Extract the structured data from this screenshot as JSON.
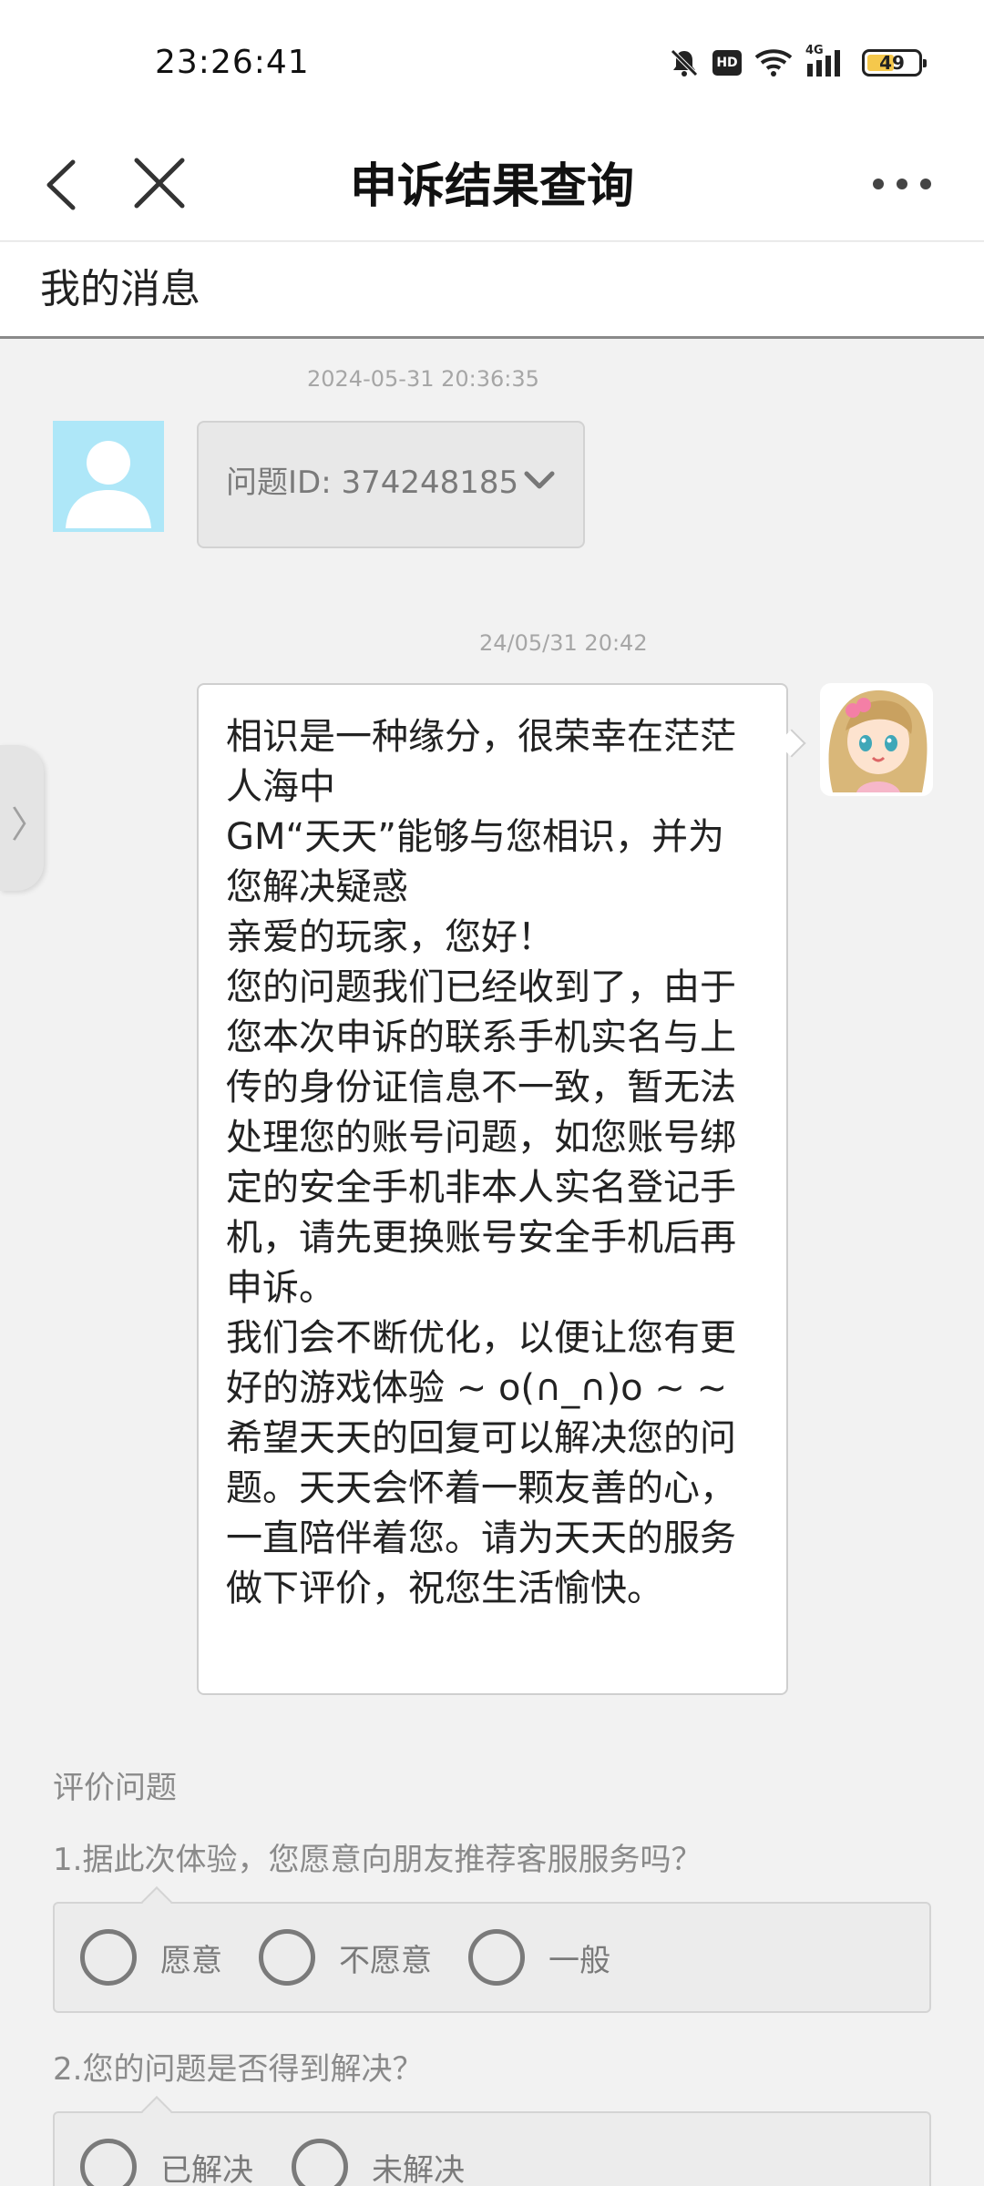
{
  "status_bar": {
    "time": "23:26:41",
    "icons": [
      "bell-muted-icon",
      "hd-icon",
      "wifi-icon",
      "signal-4g-icon"
    ],
    "network_label": "4G",
    "hd_label": "HD",
    "battery_level": "49",
    "battery_fill_color": "#f5c84c"
  },
  "nav": {
    "title": "申诉结果查询",
    "back_icon": "chevron-left-icon",
    "close_icon": "close-icon",
    "more_icon": "more-icon"
  },
  "section": {
    "title": "我的消息"
  },
  "messages": [
    {
      "timestamp": "2024-05-31 20:36:35",
      "sender": "user",
      "text": "问题ID: 374248185"
    },
    {
      "timestamp": "24/05/31 20:42",
      "sender": "gm",
      "lines": [
        "相识是一种缘分，很荣幸在茫茫人海中",
        "GM“天天”能够与您相识，并为您解决疑惑",
        "亲爱的玩家，您好！",
        "您的问题我们已经收到了，由于您本次申诉的联系手机实名与上传的身份证信息不一致，暂无法处理您的账号问题，如您账号绑定的安全手机非本人实名登记手机，请先更换账号安全手机后再申诉。",
        "我们会不断优化，以便让您有更好的游戏体验 ~ o(∩_∩)o ~ ~",
        "希望天天的回复可以解决您的问题。天天会怀着一颗友善的心，一直陪伴着您。请为天天的服务做下评价，祝您生活愉快。"
      ]
    }
  ],
  "side_handle": {
    "label": "〉"
  },
  "rating": {
    "title": "评价问题",
    "questions": [
      {
        "text": "1.据此次体验，您愿意向朋友推荐客服服务吗？",
        "options": [
          "愿意",
          "不愿意",
          "一般"
        ]
      },
      {
        "text": "2.您的问题是否得到解决？",
        "options": [
          "已解决",
          "未解决"
        ]
      }
    ]
  },
  "colors": {
    "user_avatar_bg": "#aee7f8",
    "page_bg": "#f2f2f2"
  }
}
